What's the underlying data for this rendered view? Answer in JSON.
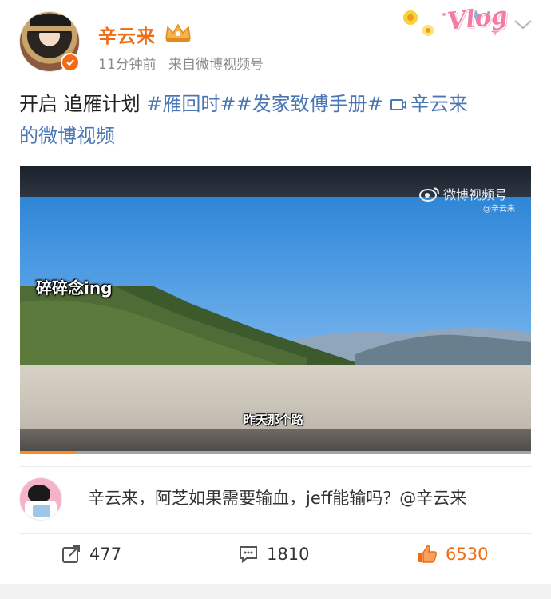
{
  "author": {
    "name": "辛云来",
    "time": "11分钟前",
    "source": "来自微博视频号"
  },
  "decor": {
    "vlog_text": "Vlog"
  },
  "post": {
    "text_prefix": "开启 追雁计划 ",
    "hashtags": "#雁回时##发家致傅手册#",
    "video_link": "辛云来",
    "text_suffix": "的微博视频"
  },
  "video": {
    "watermark": "微博视频号",
    "watermark_sub": "@辛云来",
    "caption_top": "碎碎念ing",
    "caption_bottom": "昨天那个路",
    "progress": 0.11
  },
  "comment": {
    "text": "辛云来，阿芝如果需要输血，jeff能输吗？@辛云来"
  },
  "actions": {
    "repost_count": "477",
    "comment_count": "1810",
    "like_count": "6530"
  },
  "colors": {
    "accent": "#f06c13",
    "link": "#4a76b4"
  }
}
